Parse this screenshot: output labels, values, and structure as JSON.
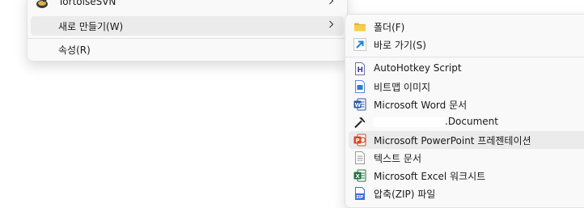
{
  "main_menu": {
    "items": [
      {
        "label": "TortoiseSVN",
        "icon": "tortoisesvn-icon",
        "has_submenu": true
      },
      {
        "label": "새로 만들기(W)",
        "has_submenu": true,
        "highlighted": true
      },
      {
        "label": "속성(R)"
      }
    ]
  },
  "new_submenu": {
    "items": [
      {
        "label": "폴더(F)",
        "icon": "folder-icon"
      },
      {
        "label": "바로 가기(S)",
        "icon": "shortcut-arrow-icon"
      },
      {
        "label": "AutoHotkey Script",
        "icon": "autohotkey-icon"
      },
      {
        "label": "비트맵 이미지",
        "icon": "bitmap-image-icon"
      },
      {
        "label": "Microsoft Word 문서",
        "icon": "word-icon"
      },
      {
        "label": ".Document",
        "icon": "hammer-icon"
      },
      {
        "label": "Microsoft PowerPoint 프레젠테이션",
        "icon": "powerpoint-icon",
        "highlighted": true
      },
      {
        "label": "텍스트 문서",
        "icon": "text-document-icon"
      },
      {
        "label": "Microsoft Excel 워크시트",
        "icon": "excel-icon"
      },
      {
        "label": "압축(ZIP) 파일",
        "icon": "zip-folder-icon"
      }
    ]
  },
  "colors": {
    "menu_bg": "#f9f9f9",
    "highlight": "#ebebeb",
    "folder": "#f4c542",
    "shortcut": "#1e7fd6",
    "word": "#2b579a",
    "powerpoint": "#d24726",
    "excel": "#217346"
  }
}
